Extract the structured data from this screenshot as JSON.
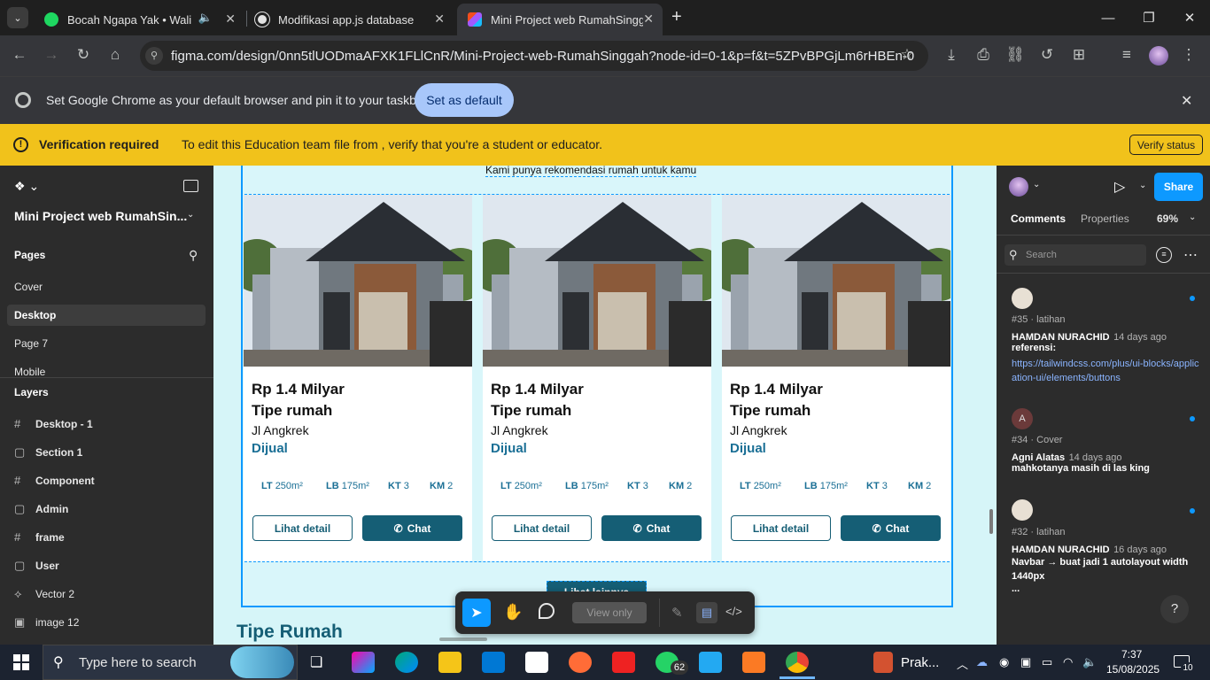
{
  "tabs": [
    {
      "title": "Bocah Ngapa Yak • Wali"
    },
    {
      "title": "Modifikasi app.js database"
    },
    {
      "title": "Mini Project web RumahSingga..."
    }
  ],
  "address": {
    "url": "figma.com/design/0nn5tlUODmaAFXK1FLlCnR/Mini-Project-web-RumahSinggah?node-id=0-1&p=f&t=5ZPvBPGjLm6rHBEn-0"
  },
  "default_banner": {
    "text": "Set Google Chrome as your default browser and pin it to your taskbar",
    "button": "Set as default"
  },
  "verification": {
    "title": "Verification required",
    "text": "To edit this Education team file from , verify that you're a student or educator.",
    "button": "Verify status"
  },
  "left_panel": {
    "file_name": "Mini Project web RumahSin...",
    "pages_label": "Pages",
    "pages": [
      "Cover",
      "Desktop",
      "Page 7",
      "Mobile"
    ],
    "layers_label": "Layers",
    "layers": [
      {
        "icon": "#",
        "name": "Desktop - 1"
      },
      {
        "icon": "▢",
        "name": "Section 1"
      },
      {
        "icon": "#",
        "name": "Component"
      },
      {
        "icon": "▢",
        "name": "Admin"
      },
      {
        "icon": "#",
        "name": "frame"
      },
      {
        "icon": "▢",
        "name": "User"
      },
      {
        "icon": "⟡",
        "name": "Vector 2"
      },
      {
        "icon": "▣",
        "name": "image 12"
      }
    ]
  },
  "canvas": {
    "top_text": "Kami punya rekomendasi rumah untuk kamu",
    "lihat_lainnya": "Lihat lainnya",
    "section_title": "Tipe Rumah",
    "cards": [
      {
        "price": "Rp 1.4 Milyar",
        "type": "Tipe rumah",
        "address": "Jl Angkrek",
        "status": "Dijual",
        "lt": "250m²",
        "lb": "175m²",
        "kt": "3",
        "km": "2",
        "detail": "Lihat detail",
        "chat": "Chat"
      },
      {
        "price": "Rp 1.4 Milyar",
        "type": "Tipe rumah",
        "address": "Jl Angkrek",
        "status": "Dijual",
        "lt": "250m²",
        "lb": "175m²",
        "kt": "3",
        "km": "2",
        "detail": "Lihat detail",
        "chat": "Chat"
      },
      {
        "price": "Rp 1.4 Milyar",
        "type": "Tipe rumah",
        "address": "Jl Angkrek",
        "status": "Dijual",
        "lt": "250m²",
        "lb": "175m²",
        "kt": "3",
        "km": "2",
        "detail": "Lihat detail",
        "chat": "Chat"
      }
    ],
    "spec_labels": {
      "lt": "LT",
      "lb": "LB",
      "kt": "KT",
      "km": "KM"
    },
    "view_only": "View only"
  },
  "right_panel": {
    "share": "Share",
    "tabs": [
      "Comments",
      "Properties"
    ],
    "zoom": "69%",
    "search_placeholder": "Search",
    "comments": [
      {
        "ref": "#35 · latihan",
        "author": "HAMDAN NURACHID",
        "time": "14 days ago",
        "line1": "referensi:",
        "link": "https://tailwindcss.com/plus/ui-blocks/application-ui/elements/buttons"
      },
      {
        "ref": "#34 · Cover",
        "author": "Agni Alatas",
        "time": "14 days ago",
        "line1": "mahkotanya masih di las king",
        "avatar": "A"
      },
      {
        "ref": "#32 · latihan",
        "author": "HAMDAN NURACHID",
        "time": "16 days ago",
        "line1": "Navbar → buat jadi 1 autolayout width 1440px",
        "line2": "..."
      }
    ]
  },
  "taskbar": {
    "search": "Type here to search",
    "prak": "Prak...",
    "whatsapp_badge": "62",
    "time": "7:37",
    "date": "15/08/2025",
    "notif": "10"
  }
}
